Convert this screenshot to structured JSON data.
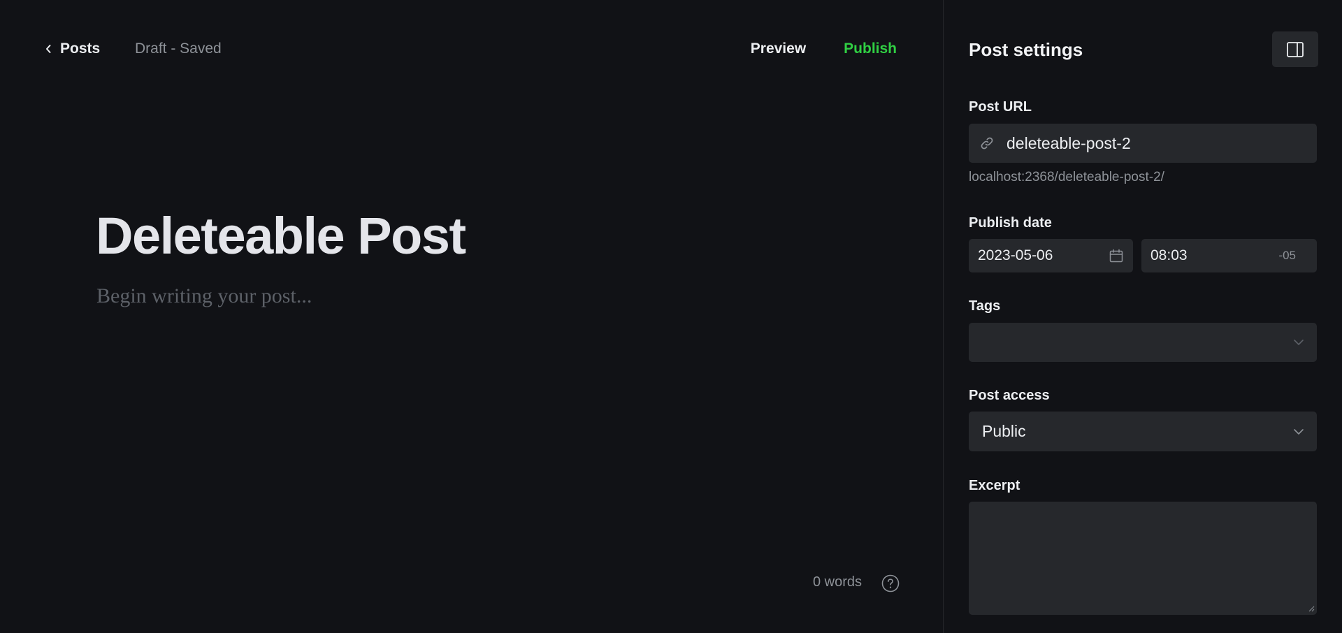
{
  "header": {
    "back_label": "Posts",
    "status": "Draft - Saved",
    "preview_label": "Preview",
    "publish_label": "Publish"
  },
  "post": {
    "title": "Deleteable Post",
    "body_placeholder": "Begin writing your post..."
  },
  "footer": {
    "word_count": "0 words"
  },
  "sidebar": {
    "title": "Post settings",
    "post_url": {
      "label": "Post URL",
      "value": "deleteable-post-2",
      "hint": "localhost:2368/deleteable-post-2/"
    },
    "publish_date": {
      "label": "Publish date",
      "date": "2023-05-06",
      "time": "08:03",
      "timezone": "-05"
    },
    "tags": {
      "label": "Tags",
      "value": ""
    },
    "post_access": {
      "label": "Post access",
      "value": "Public"
    },
    "excerpt": {
      "label": "Excerpt",
      "value": ""
    }
  },
  "colors": {
    "background": "#111216",
    "input_background": "#26282c",
    "publish_accent": "#30cf43",
    "muted_text": "#8e9298"
  },
  "icons": {
    "back": "chevron-left-icon",
    "help": "question-circle-icon",
    "sidebar_toggle": "sidebar-panel-icon",
    "link": "link-icon",
    "calendar": "calendar-icon",
    "dropdown": "chevron-down-icon"
  }
}
